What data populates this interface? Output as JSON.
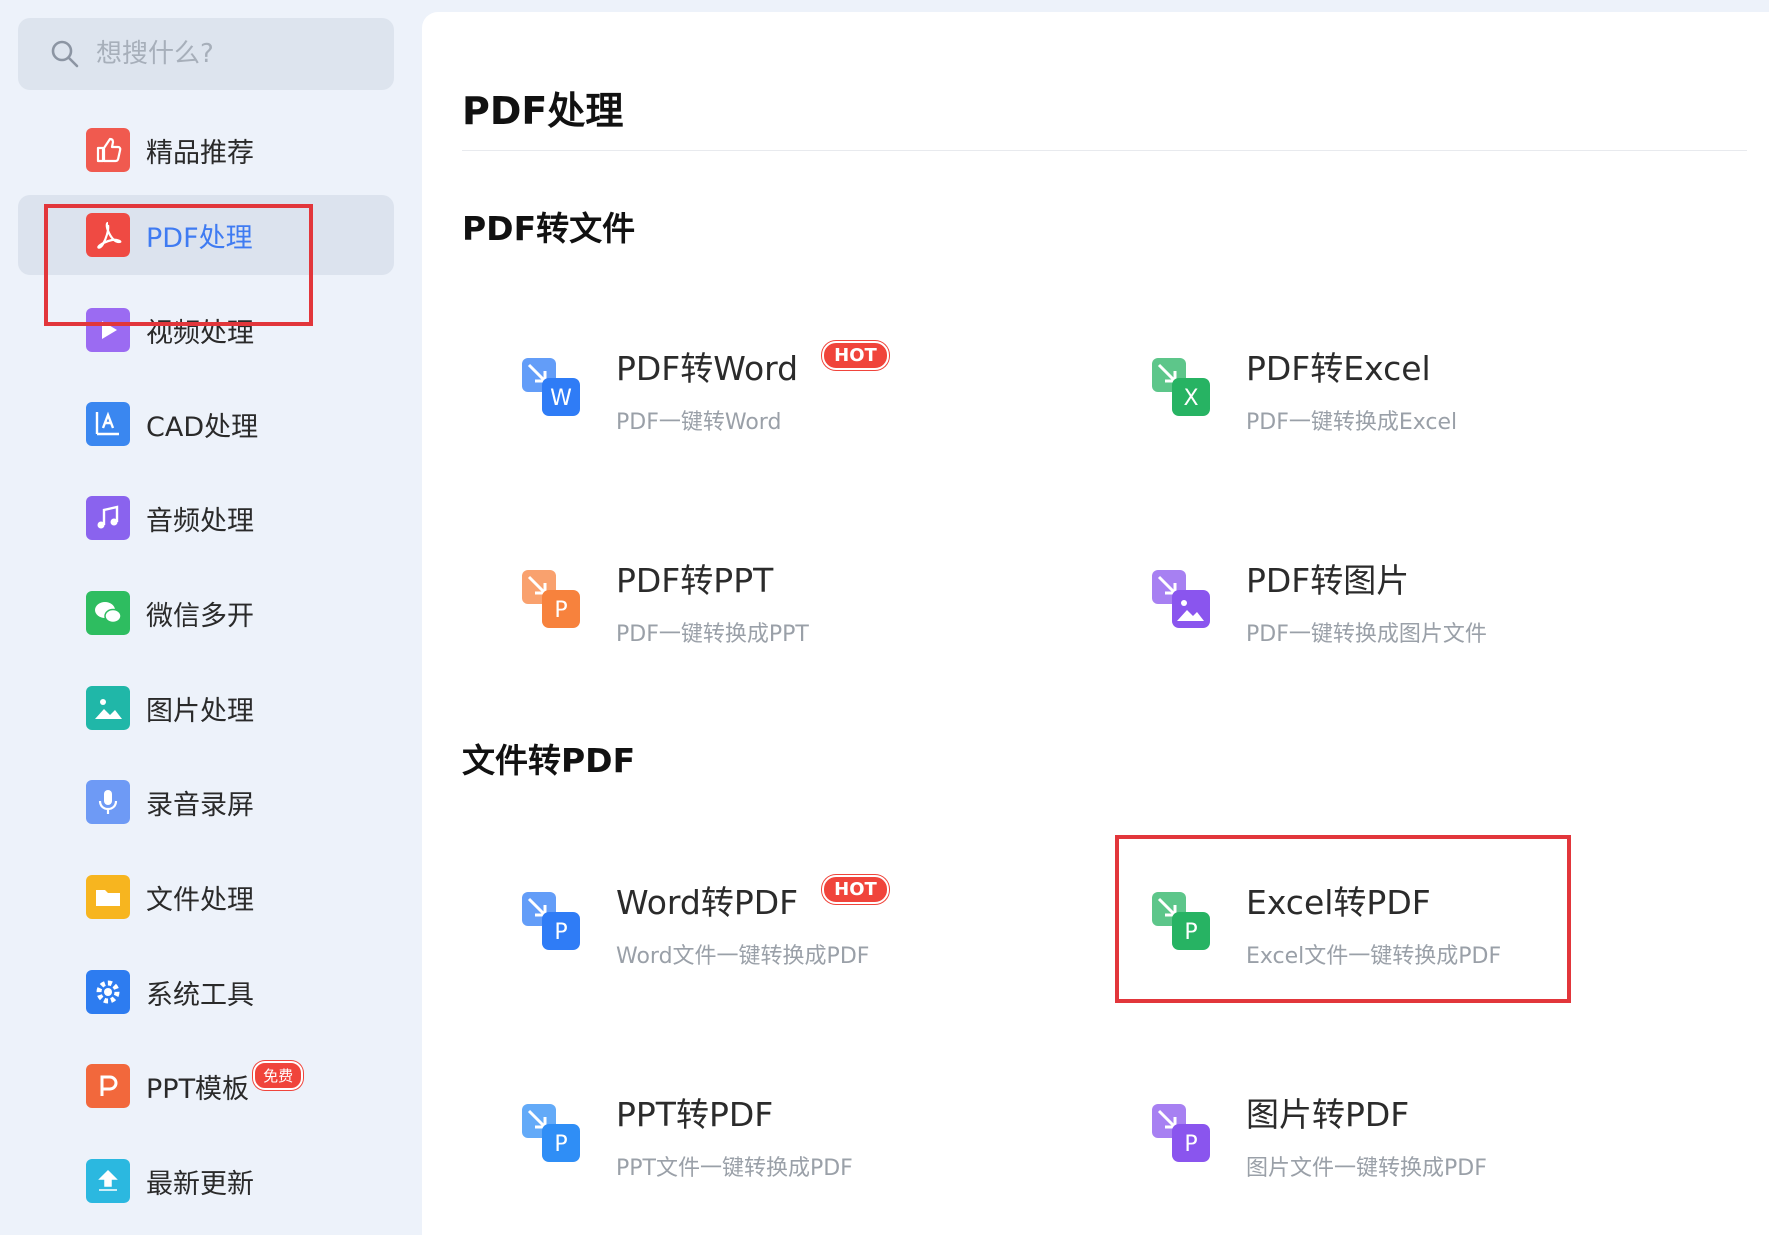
{
  "search": {
    "placeholder": "想搜什么?"
  },
  "sidebar": {
    "items": [
      {
        "label": "精品推荐",
        "color": "#f05a4f",
        "icon": "thumbs-up-icon"
      },
      {
        "label": "PDF处理",
        "color": "#ef4a43",
        "icon": "pdf-icon",
        "active": true
      },
      {
        "label": "视频处理",
        "color": "#9b6bf2",
        "icon": "play-icon"
      },
      {
        "label": "CAD处理",
        "color": "#3a87f0",
        "icon": "cad-icon"
      },
      {
        "label": "音频处理",
        "color": "#8a63ee",
        "icon": "music-icon"
      },
      {
        "label": "微信多开",
        "color": "#2ebd60",
        "icon": "wechat-icon"
      },
      {
        "label": "图片处理",
        "color": "#20b7a8",
        "icon": "image-icon"
      },
      {
        "label": "录音录屏",
        "color": "#6e9af5",
        "icon": "microphone-icon"
      },
      {
        "label": "文件处理",
        "color": "#f7b51f",
        "icon": "folder-icon"
      },
      {
        "label": "系统工具",
        "color": "#2d7cf0",
        "icon": "gear-icon"
      },
      {
        "label": "PPT模板",
        "color": "#f2683c",
        "icon": "ppt-icon",
        "badge": "免费"
      },
      {
        "label": "最新更新",
        "color": "#2bb8e0",
        "icon": "upload-icon"
      }
    ]
  },
  "main": {
    "title": "PDF处理",
    "sections": [
      {
        "title": "PDF转文件",
        "tools": [
          {
            "name": "PDF转Word",
            "desc": "PDF一键转Word",
            "letter": "W",
            "color": "#2f7cf6",
            "hot": "HOT",
            "icon": "pdf-to-word-icon"
          },
          {
            "name": "PDF转Excel",
            "desc": "PDF一键转换成Excel",
            "letter": "X",
            "color": "#27b363",
            "icon": "pdf-to-excel-icon"
          },
          {
            "name": "PDF转PPT",
            "desc": "PDF一键转换成PPT",
            "letter": "P",
            "color": "#f7823d",
            "icon": "pdf-to-ppt-icon"
          },
          {
            "name": "PDF转图片",
            "desc": "PDF一键转换成图片文件",
            "letter": "img",
            "color": "#8a55ee",
            "icon": "pdf-to-image-icon"
          }
        ]
      },
      {
        "title": "文件转PDF",
        "tools": [
          {
            "name": "Word转PDF",
            "desc": "Word文件一键转换成PDF",
            "letter": "P",
            "color": "#2f7cf6",
            "hot": "HOT",
            "icon": "word-to-pdf-icon"
          },
          {
            "name": "Excel转PDF",
            "desc": "Excel文件一键转换成PDF",
            "letter": "P",
            "color": "#27b363",
            "icon": "excel-to-pdf-icon"
          },
          {
            "name": "PPT转PDF",
            "desc": "PPT文件一键转换成PDF",
            "letter": "P",
            "color": "#2f8ef6",
            "icon": "ppt-to-pdf-icon"
          },
          {
            "name": "图片转PDF",
            "desc": "图片文件一键转换成PDF",
            "letter": "P",
            "color": "#8a55ee",
            "icon": "image-to-pdf-icon"
          }
        ]
      }
    ]
  }
}
